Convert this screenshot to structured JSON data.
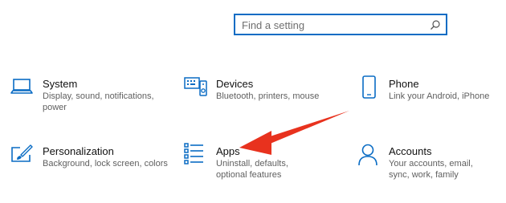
{
  "search": {
    "placeholder": "Find a setting"
  },
  "tiles": [
    {
      "title": "System",
      "desc": "Display, sound, notifications, power",
      "icon": "laptop-icon"
    },
    {
      "title": "Devices",
      "desc": "Bluetooth, printers, mouse",
      "icon": "devices-icon"
    },
    {
      "title": "Phone",
      "desc": "Link your Android, iPhone",
      "icon": "phone-icon"
    },
    {
      "title": "Personalization",
      "desc": "Background, lock screen, colors",
      "icon": "personalization-icon"
    },
    {
      "title": "Apps",
      "desc": "Uninstall, defaults, optional features",
      "icon": "apps-icon"
    },
    {
      "title": "Accounts",
      "desc": "Your accounts, email, sync, work, family",
      "icon": "accounts-icon"
    }
  ],
  "colors": {
    "accent": "#0a6cc4",
    "annotation_arrow": "#e8321e"
  }
}
